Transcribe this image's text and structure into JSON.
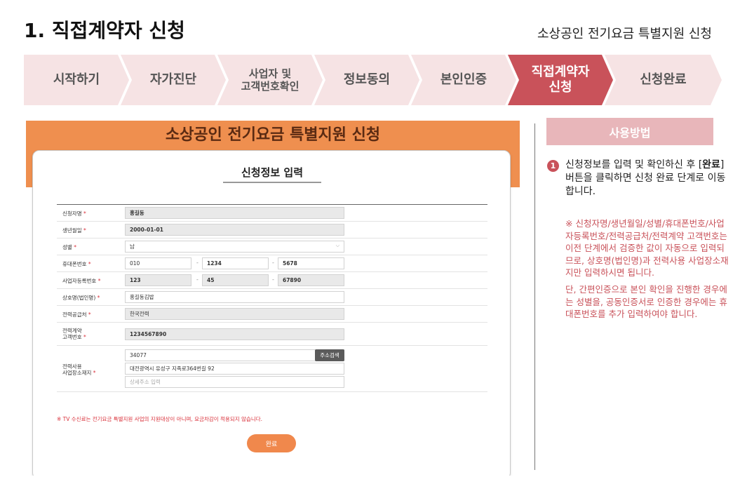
{
  "page": {
    "title": "1. 직접계약자 신청",
    "subtitle": "소상공인 전기요금 특별지원 신청"
  },
  "steps": [
    {
      "label": "시작하기",
      "active": false
    },
    {
      "label": "자가진단",
      "active": false
    },
    {
      "label": "사업자 및\n고객번호확인",
      "active": false
    },
    {
      "label": "정보동의",
      "active": false
    },
    {
      "label": "본인인증",
      "active": false
    },
    {
      "label": "직접계약자\n신청",
      "active": true
    },
    {
      "label": "신청완료",
      "active": false
    }
  ],
  "form": {
    "hero_title": "소상공인 전기요금 특별지원 신청",
    "card_title": "신청정보 입력",
    "required_mark": "*",
    "labels": {
      "applicant_name": "신청자명",
      "birth_date": "생년월일",
      "gender": "성별",
      "mobile": "휴대폰번호",
      "business_reg_no": "사업자등록번호",
      "company_name": "상호명(법인명)",
      "power_supplier": "전력공급처",
      "contract_customer_no": "전력계약\n고객번호",
      "usage_address": "전력사용\n사업장소재지"
    },
    "values": {
      "applicant_name": "홍길동",
      "birth_date": "2000-01-01",
      "gender": "남",
      "mobile_1": "010",
      "mobile_2": "1234",
      "mobile_3": "5678",
      "biz_1": "123",
      "biz_2": "45",
      "biz_3": "67890",
      "company_name": "홍길동김밥",
      "power_supplier": "한국전력",
      "contract_customer_no": "1234567890",
      "postal_code": "34077",
      "address": "대전광역시 유성구 지족로364번길 92"
    },
    "placeholders": {
      "address_detail": "상세주소 입력"
    },
    "dash": "-",
    "address_search_label": "주소검색",
    "notice": "※ TV 수신료는 전기요금 특별지원 사업의 지원대상이 아니며, 요금차감이 적용되지 않습니다.",
    "submit_label": "완료"
  },
  "help": {
    "title": "사용방법",
    "step_number": "1",
    "main_text_before": "신청정보를 입력 및 확인하신 후 [",
    "main_text_bold": "완료",
    "main_text_after": "] 버튼을 클릭하면 신청 완료 단계로 이동합니다.",
    "note_1": "※ 신청자명/생년월일/성별/휴대폰번호/사업자등록번호/전력공급처/전력계약 고객번호는 이전 단계에서 검증한 값이 자동으로 입력되므로, 상호명(법인명)과 전력사용 사업장소재지만 입력하시면 됩니다.",
    "note_2": "단, 간편인증으로 본인 확인을 진행한 경우에는 성별을, 공동인증서로 인증한 경우에는 휴대폰번호를 추가 입력하여야 합니다."
  },
  "colors": {
    "accent": "#c9525a",
    "step_bg": "#f6e3e4",
    "hero_orange": "#ef8f4f",
    "help_header": "#e8b6ba"
  }
}
